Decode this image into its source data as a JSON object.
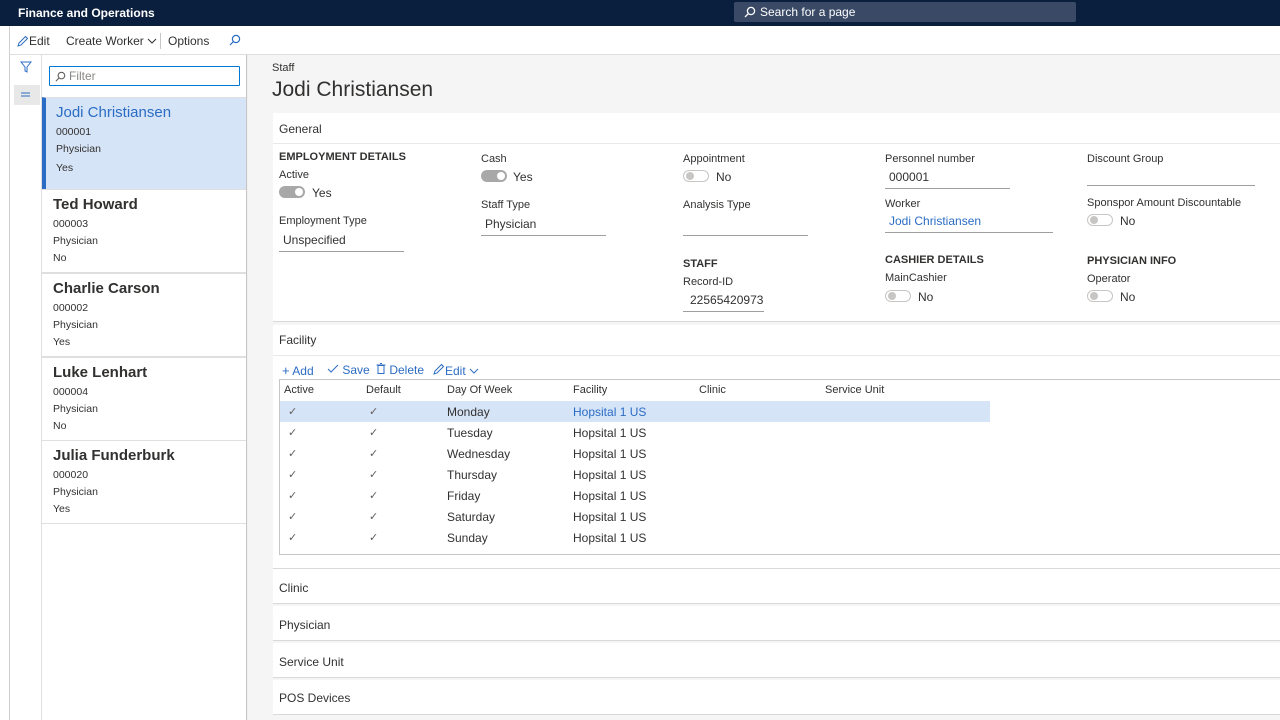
{
  "app": {
    "title": "Finance and Operations",
    "search_label": "Search for a page"
  },
  "actionpane": {
    "edit": "Edit",
    "create_worker": "Create Worker",
    "options": "Options"
  },
  "list": {
    "filter_placeholder": "Filter",
    "records": [
      {
        "name": "Jodi Christiansen",
        "number": "000001",
        "type": "Physician",
        "active": "Yes"
      },
      {
        "name": "Ted Howard",
        "number": "000003",
        "type": "Physician",
        "active": "No"
      },
      {
        "name": "Charlie Carson",
        "number": "000002",
        "type": "Physician",
        "active": "Yes"
      },
      {
        "name": "Luke Lenhart",
        "number": "000004",
        "type": "Physician",
        "active": "No"
      },
      {
        "name": "Julia Funderburk",
        "number": "000020",
        "type": "Physician",
        "active": "Yes"
      }
    ]
  },
  "page": {
    "caption": "Staff",
    "title": "Jodi Christiansen"
  },
  "general": {
    "header": "General",
    "employment_details": "EMPLOYMENT DETAILS",
    "active_label": "Active",
    "active_value": "Yes",
    "employment_type_label": "Employment Type",
    "employment_type_value": "Unspecified",
    "cash_label": "Cash",
    "cash_value": "Yes",
    "staff_type_label": "Staff Type",
    "staff_type_value": "Physician",
    "appointment_label": "Appointment",
    "appointment_value": "No",
    "analysis_type_label": "Analysis Type",
    "analysis_type_value": "",
    "staff_header": "STAFF",
    "record_id_label": "Record-ID",
    "record_id_value": "22565420973",
    "personnel_number_label": "Personnel number",
    "personnel_number_value": "000001",
    "worker_label": "Worker",
    "worker_value": "Jodi Christiansen",
    "cashier_details": "CASHIER DETAILS",
    "main_cashier_label": "MainCashier",
    "main_cashier_value": "No",
    "discount_group_label": "Discount Group",
    "discount_group_value": "",
    "sponsor_label": "Sponspor Amount Discountable",
    "sponsor_value": "No",
    "physician_info": "PHYSICIAN INFO",
    "operator_label": "Operator",
    "operator_value": "No"
  },
  "facility": {
    "header": "Facility",
    "toolbar": {
      "add": "Add",
      "save": "Save",
      "delete": "Delete",
      "edit": "Edit"
    },
    "columns": [
      "Active",
      "Default",
      "Day Of Week",
      "Facility",
      "Clinic",
      "Service Unit"
    ],
    "rows": [
      {
        "day": "Monday",
        "facility": "Hopsital 1 US"
      },
      {
        "day": "Tuesday",
        "facility": "Hopsital 1 US"
      },
      {
        "day": "Wednesday",
        "facility": "Hopsital 1 US"
      },
      {
        "day": "Thursday",
        "facility": "Hopsital 1 US"
      },
      {
        "day": "Friday",
        "facility": "Hopsital 1 US"
      },
      {
        "day": "Saturday",
        "facility": "Hopsital 1 US"
      },
      {
        "day": "Sunday",
        "facility": "Hopsital 1 US"
      }
    ]
  },
  "collapsed_sections": [
    "Clinic",
    "Physician",
    "Service Unit",
    "POS Devices"
  ]
}
